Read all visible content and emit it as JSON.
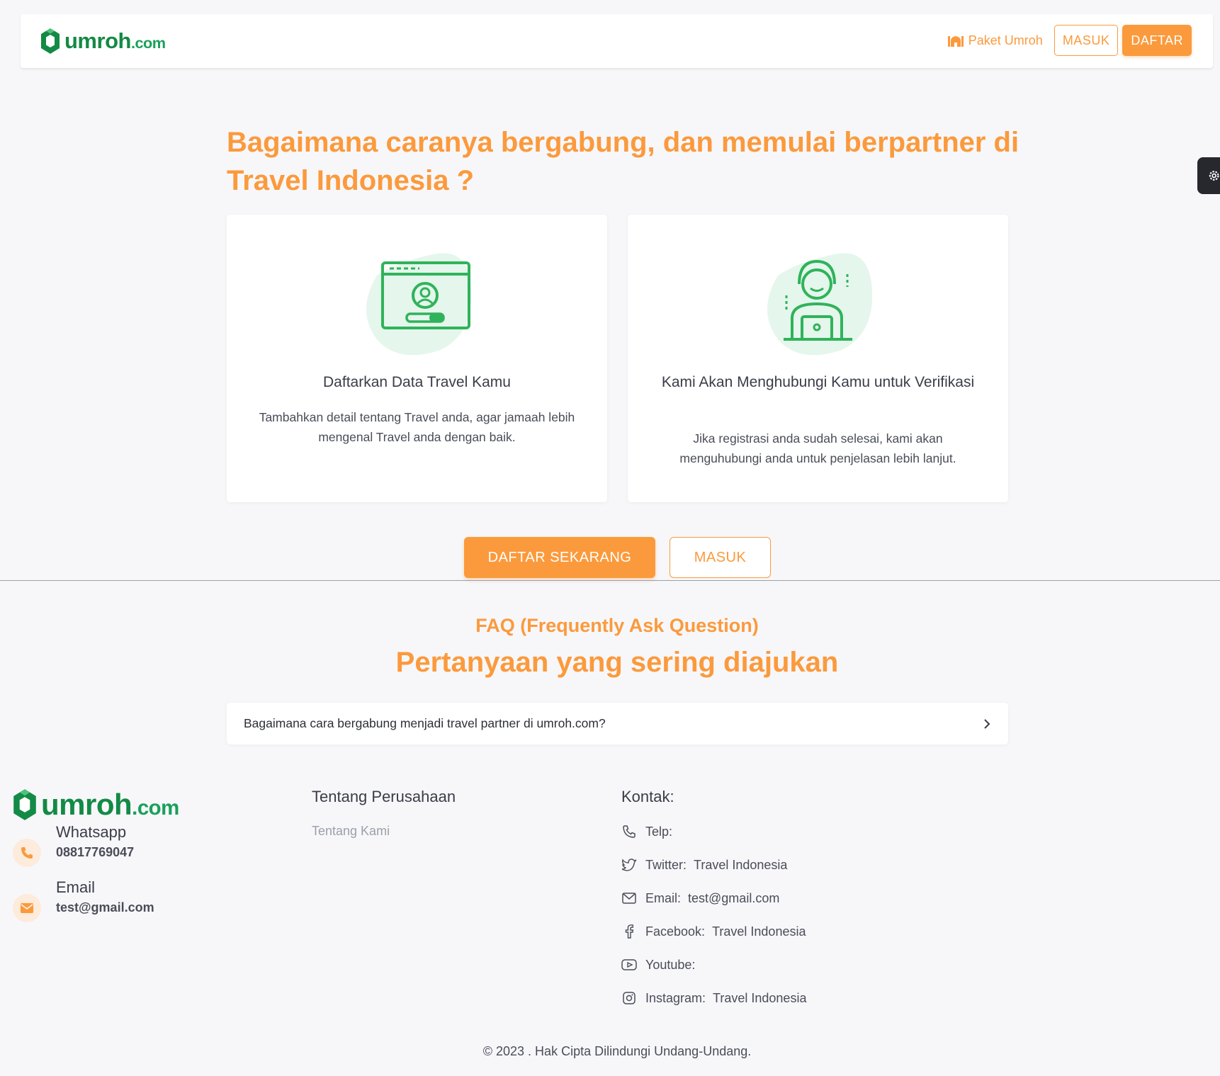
{
  "brand": {
    "name": "umroh",
    "suffix": ".com",
    "green": "#138a45",
    "accent": "#fb9a3c"
  },
  "nav": {
    "paket_label": "Paket Umroh",
    "login_label": "MASUK",
    "register_label": "DAFTAR"
  },
  "hero": {
    "title": "Bagaimana caranya bergabung, dan memulai berpartner di Travel Indonesia ?",
    "cards": [
      {
        "title": "Daftarkan Data Travel Kamu",
        "desc": "Tambahkan detail tentang Travel anda, agar jamaah lebih mengenal Travel anda dengan baik.",
        "icon": "profile-window-icon"
      },
      {
        "title": "Kami Akan Menghubungi Kamu untuk Verifikasi",
        "desc": "Jika registrasi anda sudah selesai, kami akan menguhubungi anda untuk penjelasan lebih lanjut.",
        "icon": "support-agent-icon"
      }
    ],
    "cta_primary": "DAFTAR SEKARANG",
    "cta_secondary": "MASUK"
  },
  "faq": {
    "subtitle": "FAQ (Frequently Ask Question)",
    "title": "Pertanyaan yang sering diajukan",
    "items": [
      {
        "question": "Bagaimana cara bergabung menjadi travel partner di umroh.com?"
      }
    ]
  },
  "footer": {
    "whatsapp": {
      "label": "Whatsapp",
      "value": "08817769047"
    },
    "email": {
      "label": "Email",
      "value": "test@gmail.com"
    },
    "company": {
      "heading": "Tentang Perusahaan",
      "links": [
        "Tentang Kami"
      ]
    },
    "contact": {
      "heading": "Kontak:",
      "rows": [
        {
          "label": "Telp:",
          "value": "",
          "icon": "phone-icon"
        },
        {
          "label": "Twitter:",
          "value": "Travel Indonesia",
          "icon": "twitter-icon"
        },
        {
          "label": "Email:",
          "value": "test@gmail.com",
          "icon": "mail-icon"
        },
        {
          "label": "Facebook:",
          "value": "Travel Indonesia",
          "icon": "facebook-icon"
        },
        {
          "label": "Youtube:",
          "value": "",
          "icon": "youtube-icon"
        },
        {
          "label": "Instagram:",
          "value": "Travel Indonesia",
          "icon": "instagram-icon"
        }
      ]
    },
    "copyright": "© 2023 . Hak Cipta Dilindungi Undang-Undang."
  }
}
